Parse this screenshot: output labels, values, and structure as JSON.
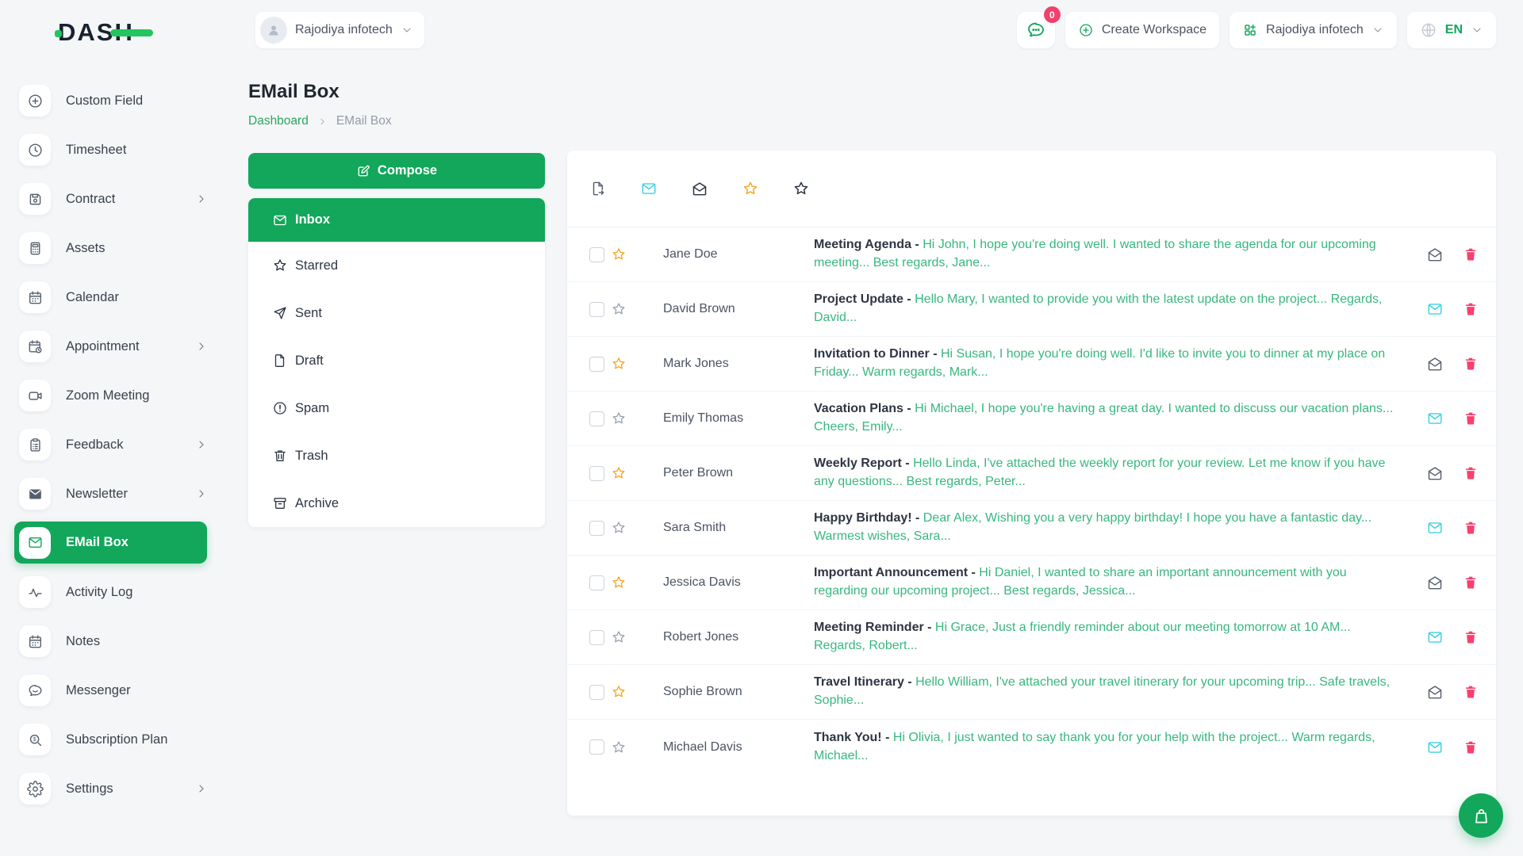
{
  "brand": {
    "logo_text": "DASH"
  },
  "header": {
    "workspace_selector": {
      "label": "Rajodiya infotech"
    },
    "messages_badge": "0",
    "create_workspace_label": "Create Workspace",
    "company_selector": {
      "label": "Rajodiya infotech"
    },
    "language": {
      "code": "EN"
    }
  },
  "sidebar": {
    "items": [
      {
        "label": "Custom Field",
        "icon": "plus-circle",
        "chevron": false,
        "active": false
      },
      {
        "label": "Timesheet",
        "icon": "clock",
        "chevron": false,
        "active": false
      },
      {
        "label": "Contract",
        "icon": "save",
        "chevron": true,
        "active": false
      },
      {
        "label": "Assets",
        "icon": "calculator",
        "chevron": false,
        "active": false
      },
      {
        "label": "Calendar",
        "icon": "calendar",
        "chevron": false,
        "active": false
      },
      {
        "label": "Appointment",
        "icon": "calendar-clock",
        "chevron": true,
        "active": false
      },
      {
        "label": "Zoom Meeting",
        "icon": "video",
        "chevron": false,
        "active": false
      },
      {
        "label": "Feedback",
        "icon": "clipboard",
        "chevron": true,
        "active": false
      },
      {
        "label": "Newsletter",
        "icon": "mail-solid",
        "chevron": true,
        "active": false
      },
      {
        "label": "EMail Box",
        "icon": "mail",
        "chevron": false,
        "active": true
      },
      {
        "label": "Activity Log",
        "icon": "activity",
        "chevron": false,
        "active": false
      },
      {
        "label": "Notes",
        "icon": "calendar",
        "chevron": false,
        "active": false
      },
      {
        "label": "Messenger",
        "icon": "message-circle",
        "chevron": false,
        "active": false
      },
      {
        "label": "Subscription Plan",
        "icon": "search-dollar",
        "chevron": false,
        "active": false
      },
      {
        "label": "Settings",
        "icon": "gear",
        "chevron": true,
        "active": false
      }
    ]
  },
  "page": {
    "title": "EMail Box",
    "breadcrumb": {
      "home": "Dashboard",
      "current": "EMail Box"
    }
  },
  "mailbox": {
    "compose_label": "Compose",
    "folders": [
      {
        "label": "Inbox",
        "icon": "mail",
        "active": true
      },
      {
        "label": "Starred",
        "icon": "star",
        "active": false
      },
      {
        "label": "Sent",
        "icon": "send",
        "active": false
      },
      {
        "label": "Draft",
        "icon": "file",
        "active": false
      },
      {
        "label": "Spam",
        "icon": "alert-circle",
        "active": false
      },
      {
        "label": "Trash",
        "icon": "trash",
        "active": false
      },
      {
        "label": "Archive",
        "icon": "archive",
        "active": false
      }
    ],
    "toolbar": [
      {
        "icon": "file-export",
        "tone": "slate"
      },
      {
        "icon": "mail",
        "tone": "cyan"
      },
      {
        "icon": "mail-open",
        "tone": "navy"
      },
      {
        "icon": "star",
        "tone": "orange"
      },
      {
        "icon": "star",
        "tone": "navy"
      }
    ],
    "emails": [
      {
        "sender": "Jane Doe",
        "subject": "Meeting Agenda -",
        "preview": "Hi John, I hope you're doing well. I wanted to share the agenda for our upcoming meeting... Best regards, Jane...",
        "starred": true,
        "unread": false
      },
      {
        "sender": "David Brown",
        "subject": "Project Update -",
        "preview": "Hello Mary, I wanted to provide you with the latest update on the project... Regards, David...",
        "starred": false,
        "unread": true
      },
      {
        "sender": "Mark Jones",
        "subject": "Invitation to Dinner -",
        "preview": "Hi Susan, I hope you're doing well. I'd like to invite you to dinner at my place on Friday... Warm regards, Mark...",
        "starred": true,
        "unread": false
      },
      {
        "sender": "Emily Thomas",
        "subject": "Vacation Plans -",
        "preview": "Hi Michael, I hope you're having a great day. I wanted to discuss our vacation plans... Cheers, Emily...",
        "starred": false,
        "unread": true
      },
      {
        "sender": "Peter Brown",
        "subject": "Weekly Report -",
        "preview": "Hello Linda, I've attached the weekly report for your review. Let me know if you have any questions... Best regards, Peter...",
        "starred": true,
        "unread": false
      },
      {
        "sender": "Sara Smith",
        "subject": "Happy Birthday! -",
        "preview": "Dear Alex, Wishing you a very happy birthday! I hope you have a fantastic day... Warmest wishes, Sara...",
        "starred": false,
        "unread": true
      },
      {
        "sender": "Jessica Davis",
        "subject": "Important Announcement -",
        "preview": "Hi Daniel, I wanted to share an important announcement with you regarding our upcoming project... Best regards, Jessica...",
        "starred": true,
        "unread": false
      },
      {
        "sender": "Robert Jones",
        "subject": "Meeting Reminder -",
        "preview": "Hi Grace, Just a friendly reminder about our meeting tomorrow at 10 AM... Regards, Robert...",
        "starred": false,
        "unread": true
      },
      {
        "sender": "Sophie Brown",
        "subject": "Travel Itinerary -",
        "preview": "Hello William, I've attached your travel itinerary for your upcoming trip... Safe travels, Sophie...",
        "starred": true,
        "unread": false
      },
      {
        "sender": "Michael Davis",
        "subject": "Thank You! -",
        "preview": "Hi Olivia, I just wanted to say thank you for your help with the project... Warm regards, Michael...",
        "starred": false,
        "unread": true
      }
    ]
  },
  "colors": {
    "primary_green": "#12a75a",
    "logo_green": "#22c55e",
    "preview_green": "#38b77e",
    "unread_cyan": "#3fd0e4",
    "trash_pink": "#fa3f6f",
    "badge_pink": "#f1416c",
    "star_orange": "#f6a623"
  }
}
